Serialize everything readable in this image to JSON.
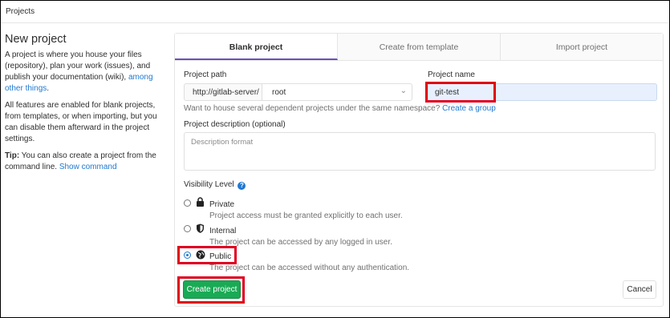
{
  "breadcrumb": "Projects",
  "sidebar": {
    "title": "New project",
    "intro": "A project is where you house your files (repository), plan your work (issues), and publish your documentation (wiki),",
    "intro_link": "among other things",
    "intro_end": ".",
    "features": "All features are enabled for blank projects, from templates, or when importing, but you can disable them afterward in the project settings.",
    "tip_label": "Tip:",
    "tip_text": "You can also create a project from the command line.",
    "tip_link": "Show command"
  },
  "tabs": [
    {
      "label": "Blank project",
      "active": true
    },
    {
      "label": "Create from template",
      "active": false
    },
    {
      "label": "Import project",
      "active": false
    }
  ],
  "form": {
    "project_path_label": "Project path",
    "path_prefix": "http://gitlab-server/",
    "namespace": "root",
    "project_name_label": "Project name",
    "project_name_value": "git-test",
    "group_hint": "Want to house several dependent projects under the same namespace?",
    "group_link": "Create a group",
    "description_label": "Project description (optional)",
    "description_placeholder": "Description format",
    "visibility_label": "Visibility Level",
    "visibility": [
      {
        "name": "Private",
        "desc": "Project access must be granted explicitly to each user.",
        "icon": "lock-icon",
        "checked": false
      },
      {
        "name": "Internal",
        "desc": "The project can be accessed by any logged in user.",
        "icon": "shield-icon",
        "checked": false
      },
      {
        "name": "Public",
        "desc": "The project can be accessed without any authentication.",
        "icon": "globe-icon",
        "checked": true
      }
    ],
    "create_label": "Create project",
    "cancel_label": "Cancel"
  },
  "colors": {
    "accent": "#1f78d1",
    "create_button": "#1aaa55",
    "highlight_box": "#e0001b",
    "active_tab_underline": "#6b4fbb"
  }
}
